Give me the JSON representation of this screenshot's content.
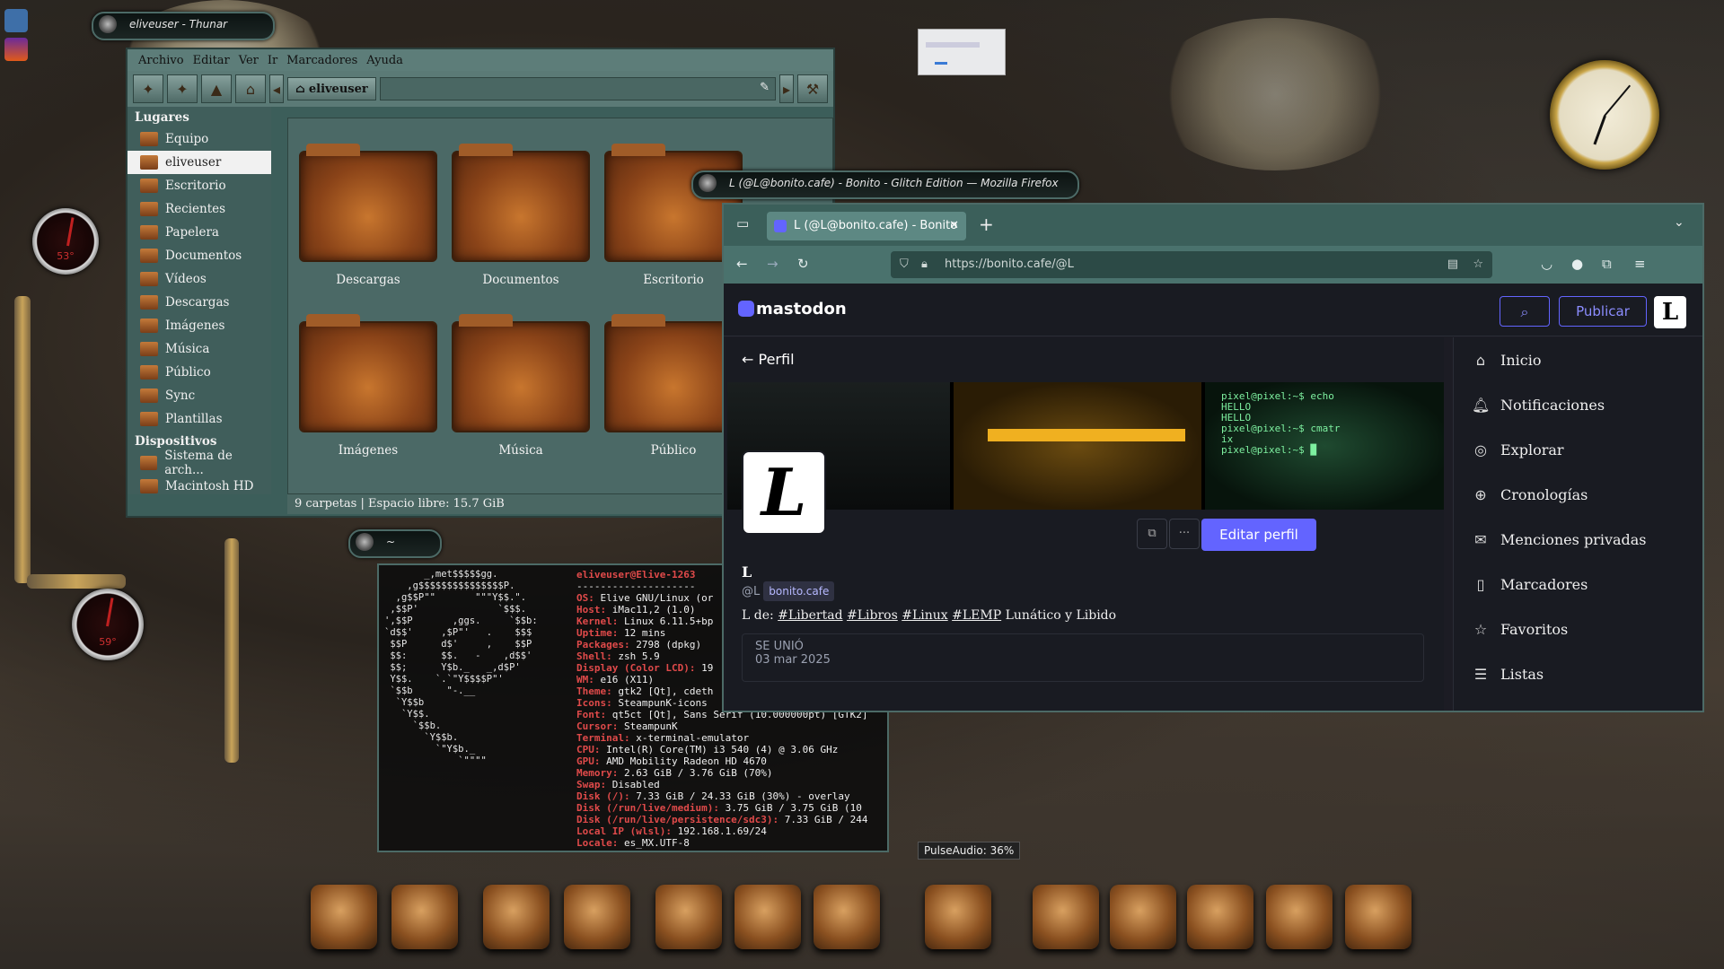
{
  "desktop": {
    "pulse_tooltip": "PulseAudio: 36%"
  },
  "thunar": {
    "title": "eliveuser - Thunar",
    "menu": [
      "Archivo",
      "Editar",
      "Ver",
      "Ir",
      "Marcadores",
      "Ayuda"
    ],
    "path_crumb": "eliveuser",
    "sidebar": {
      "places_header": "Lugares",
      "places": [
        "Equipo",
        "eliveuser",
        "Escritorio",
        "Recientes",
        "Papelera",
        "Documentos",
        "Vídeos",
        "Descargas",
        "Imágenes",
        "Música",
        "Público",
        "Sync",
        "Plantillas"
      ],
      "devices_header": "Dispositivos",
      "devices": [
        "Sistema de arch...",
        "Macintosh HD"
      ]
    },
    "folders": [
      "Descargas",
      "Documentos",
      "Escritorio",
      "Imágenes",
      "Música",
      "Público"
    ],
    "status": "9 carpetas  |  Espacio libre: 15.7 GiB"
  },
  "terminal": {
    "title": "~",
    "user_host": "eliveuser@Elive-1263",
    "separator": "--------------------",
    "ascii_logo": "       _,met$$$$$gg.\n    ,g$$$$$$$$$$$$$$$P.\n  ,g$$P\"\"       \"\"\"Y$$.\".\n ,$$P'              `$$$.\n',$$P       ,ggs.     `$$b:\n`d$$'     ,$P\"'   .    $$$\n $$P      d$'     ,    $$P\n $$:      $$.   -    ,d$$'\n $$;      Y$b._   _,d$P'\n Y$$.    `.`\"Y$$$$P\"'\n `$$b      \"-.__\n  `Y$$b\n   `Y$$.\n     `$$b.\n       `Y$$b.\n         `\"Y$b._\n             `\"\"\"\"",
    "info": [
      {
        "k": "OS:",
        "v": "Elive GNU/Linux (or"
      },
      {
        "k": "Host:",
        "v": "iMac11,2 (1.0)"
      },
      {
        "k": "Kernel:",
        "v": "Linux 6.11.5+bp"
      },
      {
        "k": "Uptime:",
        "v": "12 mins"
      },
      {
        "k": "Packages:",
        "v": "2798 (dpkg)"
      },
      {
        "k": "Shell:",
        "v": "zsh 5.9"
      },
      {
        "k": "Display (Color LCD):",
        "v": "19"
      },
      {
        "k": "WM:",
        "v": "e16 (X11)"
      },
      {
        "k": "Theme:",
        "v": "gtk2 [Qt], cdeth"
      },
      {
        "k": "Icons:",
        "v": "SteampunK-icons"
      },
      {
        "k": "Font:",
        "v": "qt5ct [Qt], Sans Serif (10.000000pt) [GTK2]"
      },
      {
        "k": "Cursor:",
        "v": "SteampunK"
      },
      {
        "k": "Terminal:",
        "v": "x-terminal-emulator"
      },
      {
        "k": "CPU:",
        "v": "Intel(R) Core(TM) i3 540 (4) @ 3.06 GHz"
      },
      {
        "k": "GPU:",
        "v": "AMD Mobility Radeon HD 4670"
      },
      {
        "k": "Memory:",
        "v": "2.63 GiB / 3.76 GiB (70%)"
      },
      {
        "k": "Swap:",
        "v": "Disabled"
      },
      {
        "k": "Disk (/):",
        "v": "7.33 GiB / 24.33 GiB (30%) - overlay"
      },
      {
        "k": "Disk (/run/live/medium):",
        "v": "3.75 GiB / 3.75 GiB (10"
      },
      {
        "k": "Disk (/run/live/persistence/sdc3):",
        "v": "7.33 GiB / 244"
      },
      {
        "k": "Local IP (wlsl):",
        "v": "192.168.1.69/24"
      },
      {
        "k": "Locale:",
        "v": "es_MX.UTF-8"
      }
    ]
  },
  "firefox": {
    "window_title": "L (@L@bonito.cafe) - Bonito - Glitch Edition — Mozilla Firefox",
    "tab_title": "L (@L@bonito.cafe) - Bonito",
    "url": "https://bonito.cafe/@L"
  },
  "mastodon": {
    "logo": "mastodon",
    "publish_label": "Publicar",
    "avatar_letter": "L",
    "back_label": "Perfil",
    "banner_text": "pixel@pixel:~$ echo\nHELLO\nHELLO\npixel@pixel:~$ cmatr\nix\npixel@pixel:~$ █",
    "edit_profile_label": "Editar perfil",
    "display_name": "L",
    "handle": "@L",
    "domain": "bonito.cafe",
    "bio_prefix": "L de:",
    "bio_tags": [
      "#Libertad",
      "#Libros",
      "#Linux",
      "#LEMP"
    ],
    "bio_suffix": "Lunático y Libido",
    "joined_label": "SE UNIÓ",
    "joined_date": "03 mar 2025",
    "nav": [
      {
        "icon": "home-icon",
        "glyph": "⌂",
        "label": "Inicio"
      },
      {
        "icon": "bell-icon",
        "glyph": "🔔︎",
        "label": "Notificaciones"
      },
      {
        "icon": "compass-icon",
        "glyph": "◎",
        "label": "Explorar"
      },
      {
        "icon": "globe-icon",
        "glyph": "⊕",
        "label": "Cronologías"
      },
      {
        "icon": "mail-icon",
        "glyph": "✉",
        "label": "Menciones privadas"
      },
      {
        "icon": "bookmark-icon",
        "glyph": "▯",
        "label": "Marcadores"
      },
      {
        "icon": "star-icon",
        "glyph": "☆",
        "label": "Favoritos"
      },
      {
        "icon": "list-icon",
        "glyph": "☰",
        "label": "Listas"
      }
    ]
  },
  "gauges": {
    "cpu": "53°",
    "temp": "59°"
  },
  "colors": {
    "accent": "#6364ff",
    "window_chrome": "#3b5f5a",
    "terminal_key": "#e04a4a"
  }
}
